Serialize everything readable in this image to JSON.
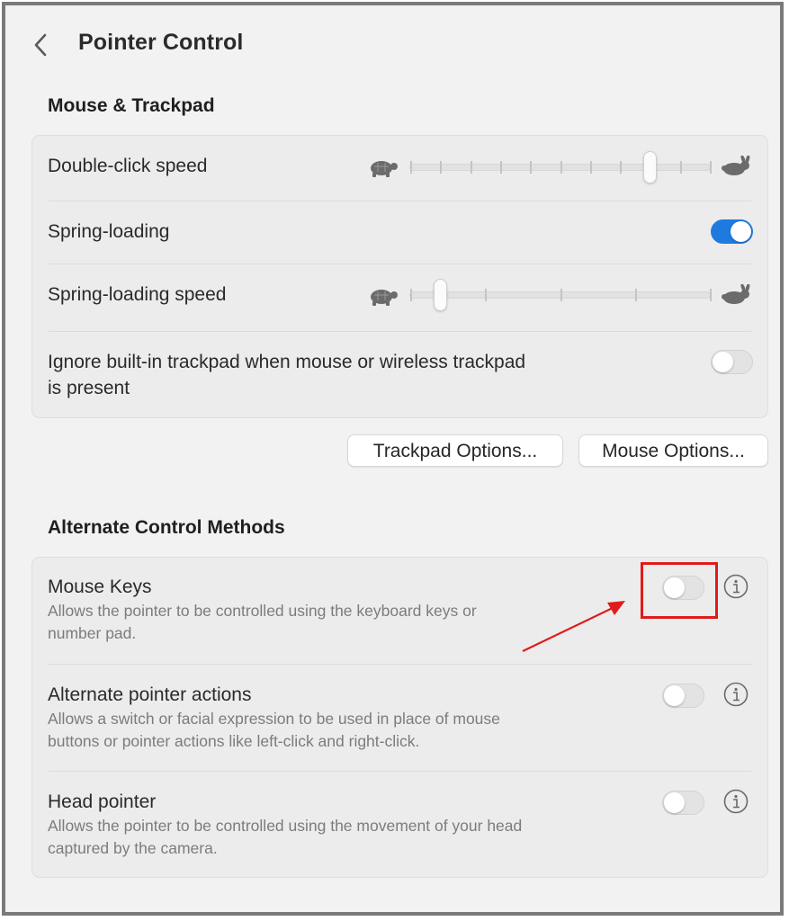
{
  "header": {
    "title": "Pointer Control"
  },
  "mouse_trackpad": {
    "section_title": "Mouse & Trackpad",
    "double_click_speed": {
      "label": "Double-click speed",
      "level": 0.8,
      "ticks": 11
    },
    "spring_loading": {
      "label": "Spring-loading",
      "enabled": true
    },
    "spring_loading_speed": {
      "label": "Spring-loading speed",
      "level": 0.1,
      "ticks": 5
    },
    "ignore_trackpad": {
      "label_line1": "Ignore built-in trackpad when mouse or wireless trackpad",
      "label_line2": "is present",
      "enabled": false
    },
    "buttons": {
      "trackpad_options": "Trackpad Options...",
      "mouse_options": "Mouse Options..."
    }
  },
  "alternate_control": {
    "section_title": "Alternate Control Methods",
    "items": [
      {
        "label": "Mouse Keys",
        "desc_line1": "Allows the pointer to be controlled using the keyboard keys or",
        "desc_line2": "number pad.",
        "enabled": false
      },
      {
        "label": "Alternate pointer actions",
        "desc_line1": "Allows a switch or facial expression to be used in place of mouse",
        "desc_line2": "buttons or pointer actions like left-click and right-click.",
        "enabled": false
      },
      {
        "label": "Head pointer",
        "desc_line1": "Allows the pointer to be controlled using the movement of your head",
        "desc_line2": "captured by the camera.",
        "enabled": false
      }
    ]
  },
  "icons": {
    "slow": "turtle-icon",
    "fast": "rabbit-icon",
    "info": "info-icon",
    "back": "chevron-left-icon"
  },
  "colors": {
    "accent": "#1f7ae0",
    "annotation": "#e01b1b"
  }
}
